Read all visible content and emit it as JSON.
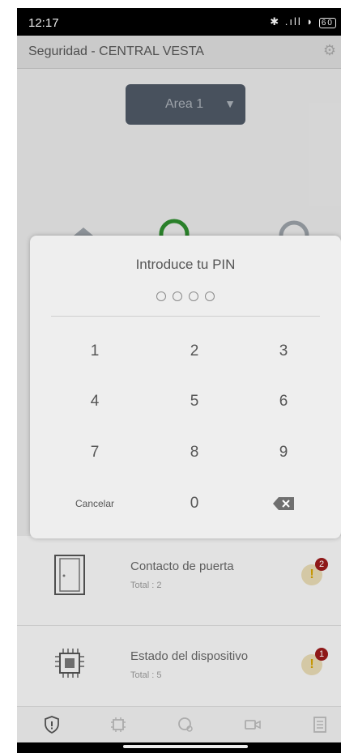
{
  "status_bar": {
    "time": "12:17",
    "icons": [
      "alarm-icon",
      "teams-icon",
      "bluetooth-icon",
      "signal-icon",
      "wifi-icon",
      "battery-icon"
    ],
    "battery": "60"
  },
  "app_bar": {
    "title": "Seguridad - CENTRAL VESTA",
    "settings_icon": "gear-icon"
  },
  "area_selector": {
    "label": "Area 1"
  },
  "devices": [
    {
      "name": "Contacto de puerta",
      "total": "Total : 2",
      "badge": "2",
      "warn": "!"
    },
    {
      "name": "Estado del dispositivo",
      "total": "Total : 5",
      "badge": "1",
      "warn": "!"
    }
  ],
  "pin_dialog": {
    "title": "Introduce tu PIN",
    "keys": [
      "1",
      "2",
      "3",
      "4",
      "5",
      "6",
      "7",
      "8",
      "9",
      "0"
    ],
    "cancel_label": "Cancelar"
  },
  "colors": {
    "accent_green": "#2e8b2e",
    "badge_red": "#9b1b1b",
    "warning_yellow": "#d6a200",
    "area_selector_bg": "#4f5865"
  }
}
